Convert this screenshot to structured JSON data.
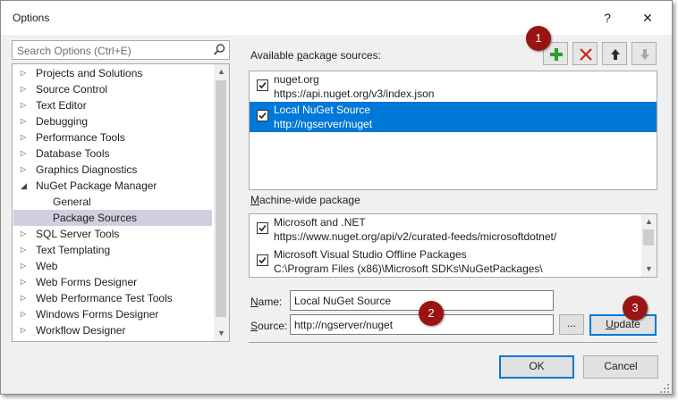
{
  "window": {
    "title": "Options",
    "help_label": "?",
    "close_label": "✕"
  },
  "search": {
    "placeholder": "Search Options (Ctrl+E)"
  },
  "tree": {
    "items": [
      {
        "label": "Projects and Solutions",
        "state": "collapsed"
      },
      {
        "label": "Source Control",
        "state": "collapsed"
      },
      {
        "label": "Text Editor",
        "state": "collapsed"
      },
      {
        "label": "Debugging",
        "state": "collapsed"
      },
      {
        "label": "Performance Tools",
        "state": "collapsed"
      },
      {
        "label": "Database Tools",
        "state": "collapsed"
      },
      {
        "label": "Graphics Diagnostics",
        "state": "collapsed"
      },
      {
        "label": "NuGet Package Manager",
        "state": "expanded"
      },
      {
        "label": "General",
        "state": "child"
      },
      {
        "label": "Package Sources",
        "state": "child-selected"
      },
      {
        "label": "SQL Server Tools",
        "state": "collapsed"
      },
      {
        "label": "Text Templating",
        "state": "collapsed"
      },
      {
        "label": "Web",
        "state": "collapsed"
      },
      {
        "label": "Web Forms Designer",
        "state": "collapsed"
      },
      {
        "label": "Web Performance Test Tools",
        "state": "collapsed"
      },
      {
        "label": "Windows Forms Designer",
        "state": "collapsed"
      },
      {
        "label": "Workflow Designer",
        "state": "collapsed"
      }
    ]
  },
  "available": {
    "label_pre": "Available ",
    "label_access": "p",
    "label_post": "ackage sources:",
    "sources": [
      {
        "name": "nuget.org",
        "url": "https://api.nuget.org/v3/index.json",
        "checked": true,
        "selected": false
      },
      {
        "name": "Local NuGet Source",
        "url": "http://ngserver/nuget",
        "checked": true,
        "selected": true
      }
    ]
  },
  "machine": {
    "label_access": "M",
    "label_post": "achine-wide package",
    "sources": [
      {
        "name": "Microsoft and .NET",
        "url": "https://www.nuget.org/api/v2/curated-feeds/microsoftdotnet/",
        "checked": true
      },
      {
        "name": "Microsoft Visual Studio Offline Packages",
        "url": "C:\\Program Files (x86)\\Microsoft SDKs\\NuGetPackages\\",
        "checked": true
      }
    ]
  },
  "form": {
    "name_access": "N",
    "name_post": "ame:",
    "name_value": "Local NuGet Source",
    "source_access": "S",
    "source_post": "ource:",
    "source_value": "http://ngserver/nuget",
    "browse_label": "...",
    "update_access": "U",
    "update_post": "pdate"
  },
  "footer": {
    "ok_label": "OK",
    "cancel_label": "Cancel"
  },
  "callouts": [
    "1",
    "2",
    "3"
  ],
  "colors": {
    "selection": "#0078d7",
    "callout": "#9b1414",
    "add_icon": "#2e9e2e",
    "remove_icon": "#c42b1c"
  },
  "icons": {
    "add": "plus-icon",
    "remove": "x-icon",
    "move_up": "arrow-up-icon",
    "move_down": "arrow-down-icon"
  }
}
